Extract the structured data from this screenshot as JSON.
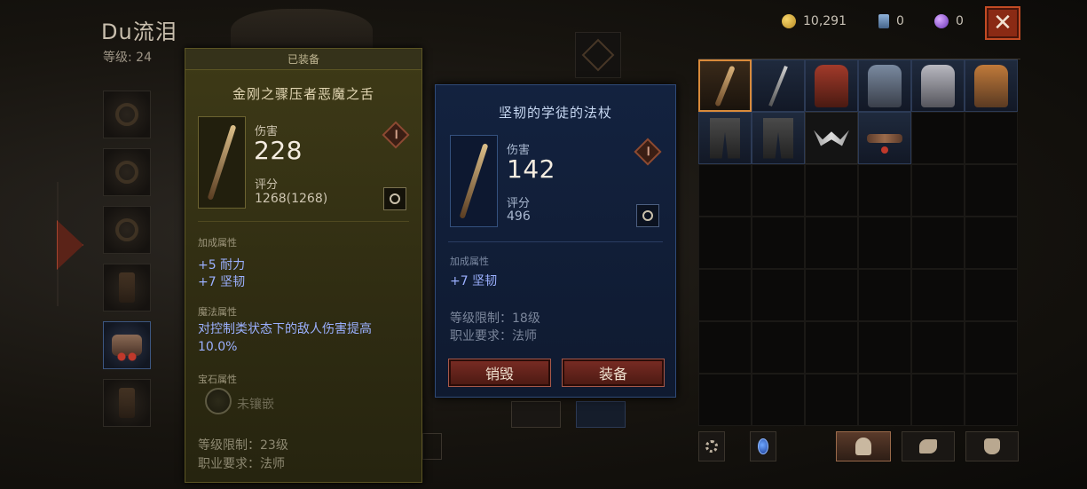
{
  "character": {
    "name": "Du流泪",
    "level_text": "等级: 24"
  },
  "currencies": [
    {
      "icon": "coin-icon",
      "value": "10,291"
    },
    {
      "icon": "card-icon",
      "value": "0"
    },
    {
      "icon": "orb-icon",
      "value": "0"
    }
  ],
  "close_label": "✕",
  "equipped_item": {
    "header": "已装备",
    "name": "金刚之骤压者恶魔之舌",
    "damage_label": "伤害",
    "damage_value": "228",
    "score_label": "评分",
    "score_value": "1268(1268)",
    "bonus_label": "加成属性",
    "bonus_attrs": [
      "+5 耐力",
      "+7 坚韧"
    ],
    "magic_label": "魔法属性",
    "magic_text": "对控制类状态下的敌人伤害提高10.0%",
    "gem_label": "宝石属性",
    "gem_text": "未镶嵌",
    "level_req": "等级限制：23级",
    "class_req": "职业要求：法师"
  },
  "new_item": {
    "name": "坚韧的学徒的法杖",
    "damage_label": "伤害",
    "damage_value": "142",
    "score_label": "评分",
    "score_value": "496",
    "bonus_label": "加成属性",
    "bonus_attrs": [
      "+7 坚韧"
    ],
    "level_req": "等级限制：18级",
    "class_req": "职业要求：法师",
    "destroy_label": "销毁",
    "equip_label": "装备"
  },
  "colors": {
    "equipped_panel": "#2f2c12",
    "new_panel": "#13223f",
    "attr_blue": "#9bb0ff",
    "close_red": "#8a2a14",
    "selected_border": "#d98a3a"
  }
}
